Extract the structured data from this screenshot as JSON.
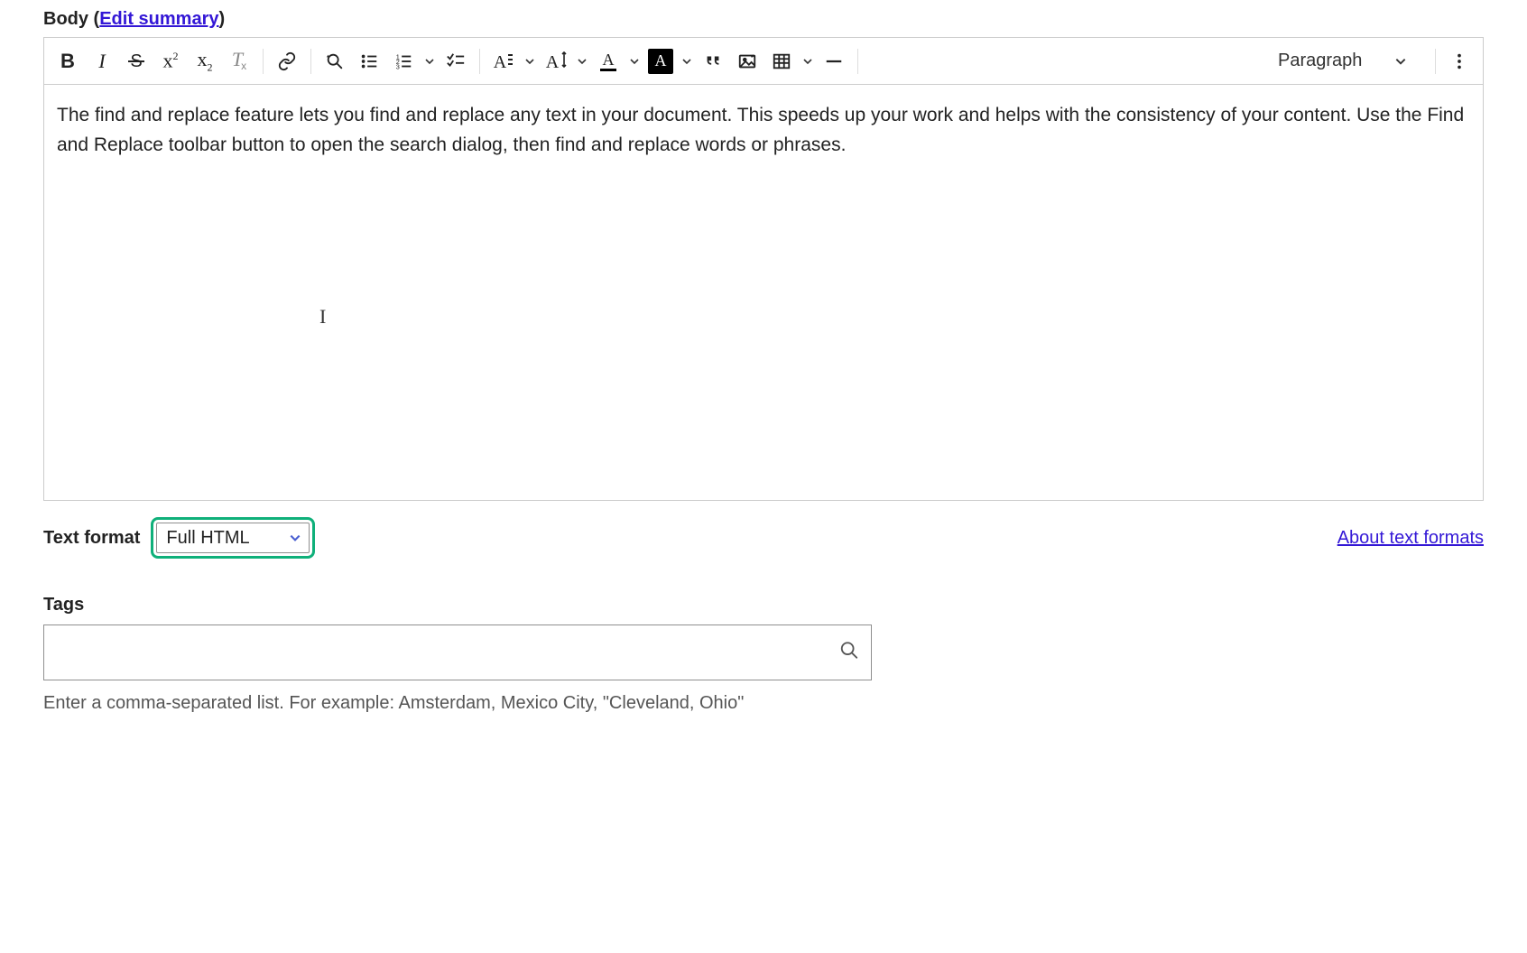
{
  "body": {
    "label_text": "Body",
    "paren_open": " (",
    "edit_summary_link": "Edit summary",
    "paren_close": ")"
  },
  "editor": {
    "content": "The find and replace feature lets you find and replace any text in your document. This speeds up your work and helps with the consistency of your content.  Use the Find and Replace toolbar button to open the search dialog, then find and replace words or phrases.",
    "heading_value": "Paragraph"
  },
  "text_format": {
    "label": "Text format",
    "value": "Full HTML",
    "about_link": "About text formats"
  },
  "tags": {
    "label": "Tags",
    "value": "",
    "help": "Enter a comma-separated list. For example: Amsterdam, Mexico City, \"Cleveland, Ohio\""
  }
}
